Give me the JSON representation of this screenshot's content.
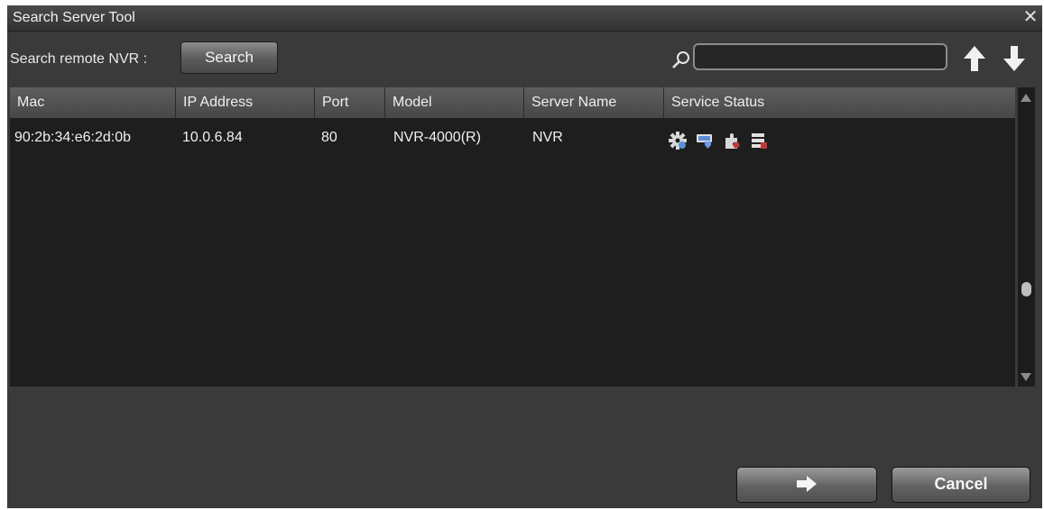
{
  "window": {
    "title": "Search Server Tool",
    "close_glyph": "✕"
  },
  "search": {
    "label": "Search remote NVR :",
    "button_label": "Search",
    "filter_value": ""
  },
  "table": {
    "columns": [
      "Mac",
      "IP Address",
      "Port",
      "Model",
      "Server Name",
      "Service Status"
    ],
    "rows": [
      {
        "mac": "90:2b:34:e6:2d:0b",
        "ip": "10.0.6.84",
        "port": "80",
        "model": "NVR-4000(R)",
        "server_name": "NVR",
        "service_status_icons": [
          "gear-icon",
          "monitor-shield-icon",
          "puzzle-icon",
          "server-list-icon"
        ]
      }
    ]
  },
  "footer": {
    "next_icon": "arrow-right-icon",
    "cancel_label": "Cancel"
  },
  "colors": {
    "accent_blue": "#5a8fd8",
    "accent_red": "#c23a3a"
  }
}
